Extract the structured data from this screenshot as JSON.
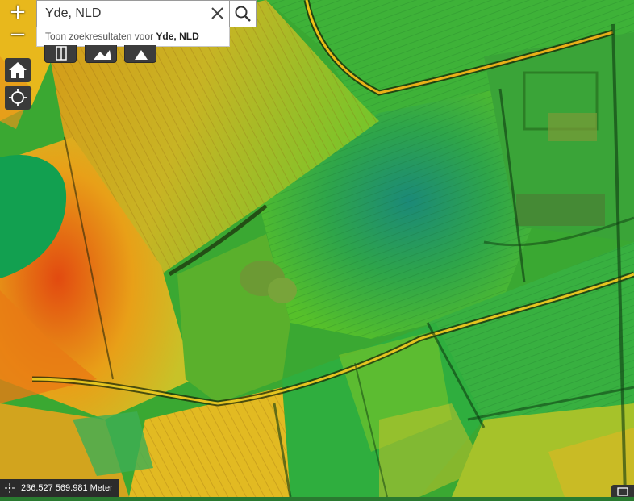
{
  "map": {
    "layer": "elevation-hillshade",
    "colors": {
      "low": "#1a9a52",
      "mid": "#58c22a",
      "high": "#e0c028",
      "peak": "#e06818",
      "ridge": "#e4a41c"
    }
  },
  "search": {
    "value": "Yde, NLD",
    "suggestion_prefix": "Toon zoekresultaten voor ",
    "suggestion_term": "Yde, NLD",
    "icons": {
      "clear": "close-icon",
      "submit": "search-icon"
    }
  },
  "controls": {
    "zoom_in_label": "+",
    "zoom_out_label": "−",
    "home_icon": "home-icon",
    "locate_icon": "locate-icon",
    "tools": [
      "layers-icon",
      "basemap-icon",
      "measure-icon"
    ]
  },
  "status": {
    "coordinates": "236.527 569.981 Meter"
  }
}
